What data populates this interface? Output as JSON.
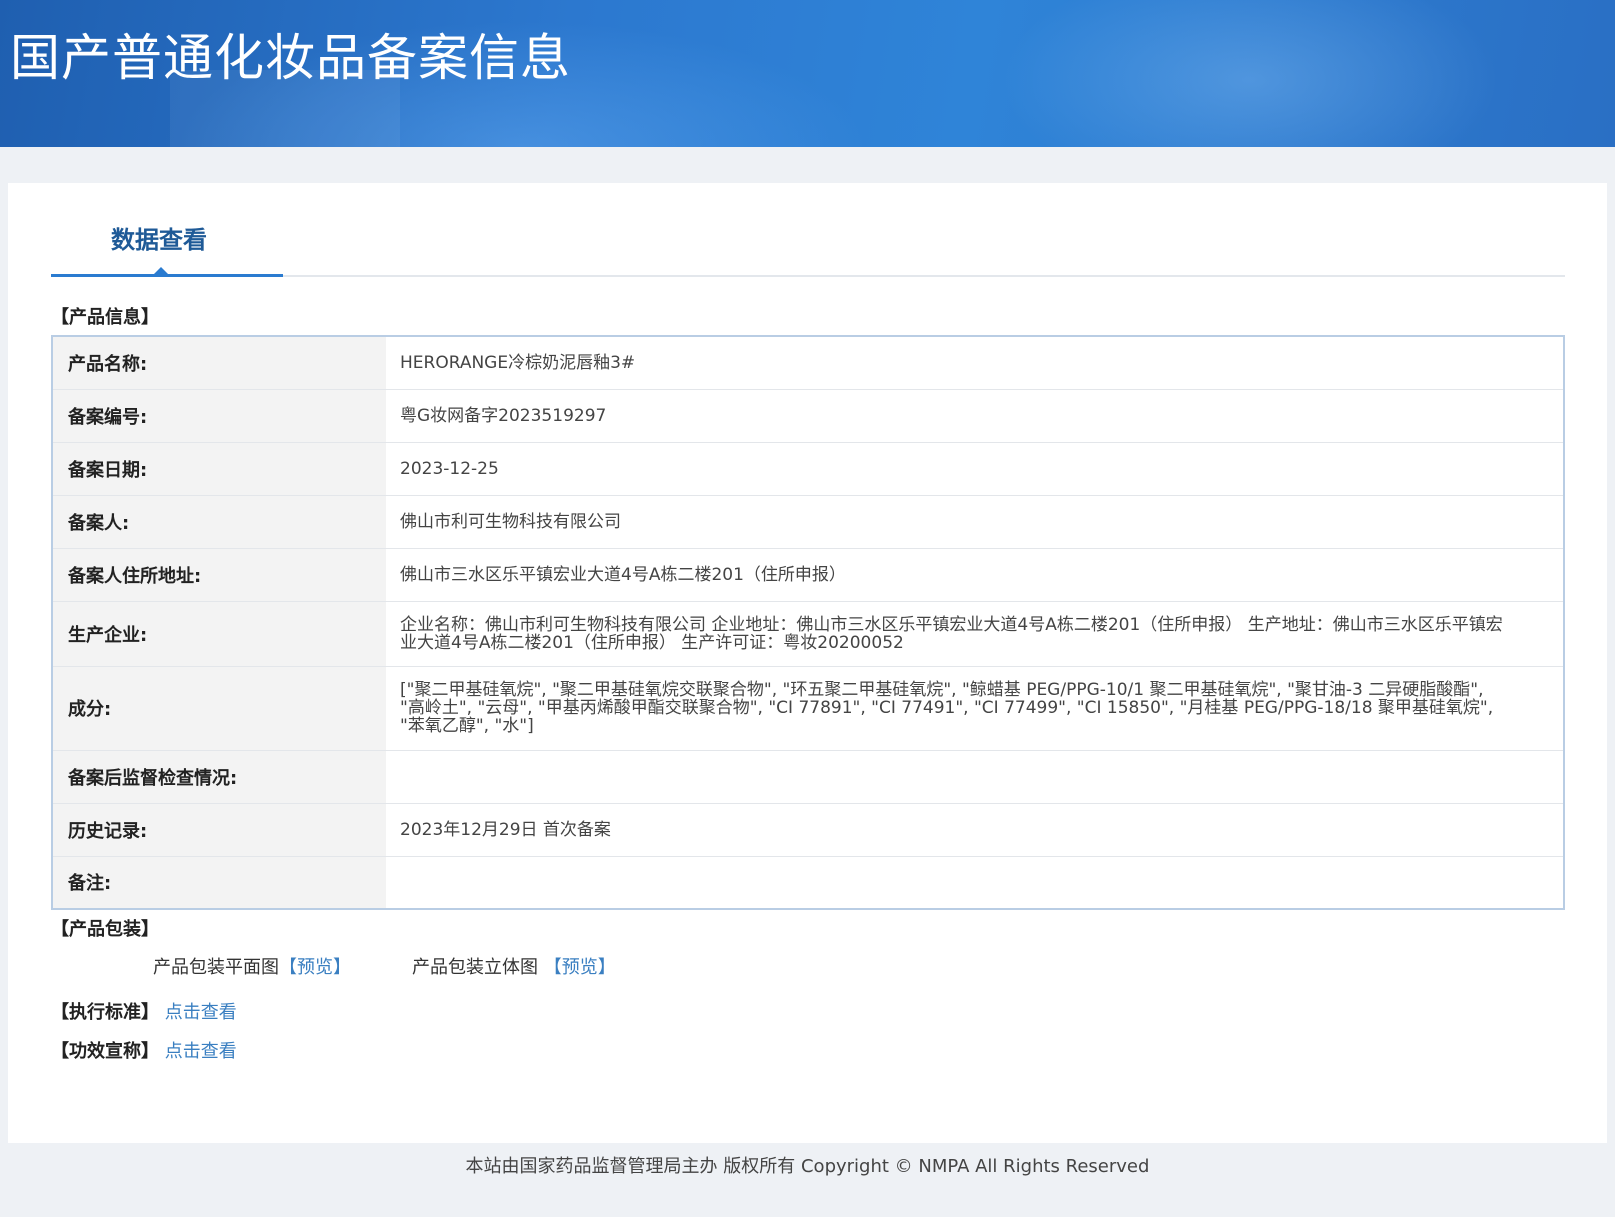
{
  "header": {
    "title": "国产普通化妆品备案信息"
  },
  "tab": {
    "label": "数据查看"
  },
  "product_info": {
    "section_title": "【产品信息】",
    "rows": [
      {
        "label": "产品名称:",
        "value": "HERORANGE冷棕奶泥唇釉3#"
      },
      {
        "label": "备案编号:",
        "value": "粤G妆网备字2023519297"
      },
      {
        "label": "备案日期:",
        "value": "2023-12-25"
      },
      {
        "label": "备案人:",
        "value": "佛山市利可生物科技有限公司"
      },
      {
        "label": "备案人住所地址:",
        "value": "佛山市三水区乐平镇宏业大道4号A栋二楼201（住所申报）"
      },
      {
        "label": "生产企业:",
        "value": "企业名称：佛山市利可生物科技有限公司 企业地址：佛山市三水区乐平镇宏业大道4号A栋二楼201（住所申报） 生产地址：佛山市三水区乐平镇宏业大道4号A栋二楼201（住所申报） 生产许可证：粤妆20200052"
      },
      {
        "label": "成分:",
        "value": "[\"聚二甲基硅氧烷\", \"聚二甲基硅氧烷交联聚合物\", \"环五聚二甲基硅氧烷\", \"鲸蜡基 PEG/PPG-10/1 聚二甲基硅氧烷\", \"聚甘油-3 二异硬脂酸酯\", \"高岭土\", \"云母\", \"甲基丙烯酸甲酯交联聚合物\", \"CI 77891\", \"CI 77491\", \"CI 77499\", \"CI 15850\", \"月桂基 PEG/PPG-18/18 聚甲基硅氧烷\", \"苯氧乙醇\", \"水\"]"
      },
      {
        "label": "备案后监督检查情况:",
        "value": ""
      },
      {
        "label": "历史记录:",
        "value": "2023年12月29日 首次备案"
      },
      {
        "label": "备注:",
        "value": ""
      }
    ]
  },
  "packaging": {
    "section_title": "【产品包装】",
    "flat_label": "产品包装平面图",
    "flat_link": "【预览】",
    "solid_label": "产品包装立体图",
    "solid_link": "【预览】"
  },
  "standard": {
    "section_title": "【执行标准】",
    "link": "点击查看"
  },
  "efficacy": {
    "section_title": "【功效宣称】",
    "link": "点击查看"
  },
  "footer": {
    "text": "本站由国家药品监督管理局主办 版权所有 Copyright © NMPA All Rights Reserved"
  }
}
